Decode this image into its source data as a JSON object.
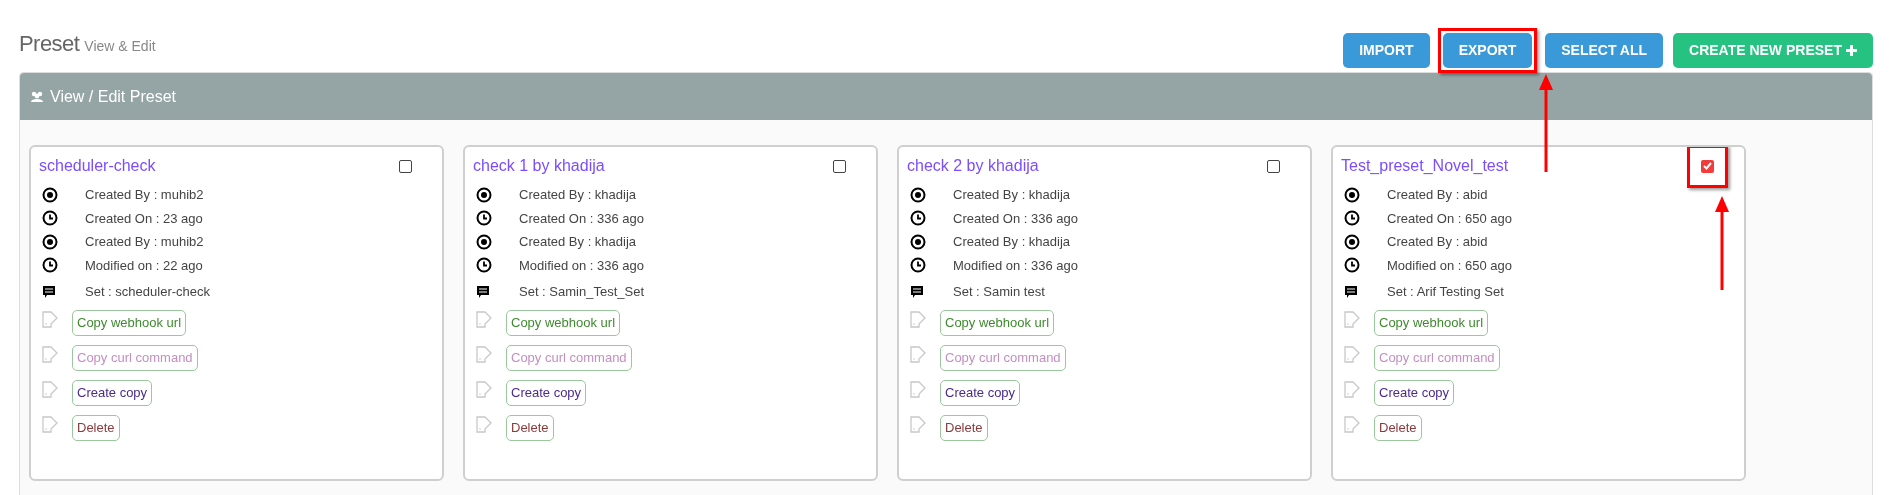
{
  "page": {
    "title": "Preset",
    "subtitle": "View & Edit"
  },
  "buttons": [
    {
      "label": "IMPORT",
      "kind": "blue",
      "highlighted": false
    },
    {
      "label": "EXPORT",
      "kind": "blue",
      "highlighted": true
    },
    {
      "label": "SELECT ALL",
      "kind": "blue",
      "highlighted": false
    },
    {
      "label": "CREATE NEW PRESET",
      "kind": "green",
      "highlighted": false
    }
  ],
  "panel": {
    "title": "View / Edit Preset"
  },
  "cards": [
    {
      "title": "scheduler-check",
      "checked": false,
      "highlighted": false,
      "info": [
        {
          "kind": "user",
          "text": "Created By : muhib2"
        },
        {
          "kind": "time",
          "text": "Created On : 23 ago"
        },
        {
          "kind": "user",
          "text": "Created By : muhib2"
        },
        {
          "kind": "time",
          "text": "Modified on : 22 ago"
        },
        {
          "kind": "set",
          "text": "Set : scheduler-check"
        }
      ],
      "actions": [
        {
          "kind": "webhook",
          "label": "Copy webhook url"
        },
        {
          "kind": "curl",
          "label": "Copy curl command"
        },
        {
          "kind": "copy",
          "label": "Create copy"
        },
        {
          "kind": "delete",
          "label": "Delete"
        }
      ]
    },
    {
      "title": "check 1 by khadija",
      "checked": false,
      "highlighted": false,
      "info": [
        {
          "kind": "user",
          "text": "Created By : khadija"
        },
        {
          "kind": "time",
          "text": "Created On : 336 ago"
        },
        {
          "kind": "user",
          "text": "Created By : khadija"
        },
        {
          "kind": "time",
          "text": "Modified on : 336 ago"
        },
        {
          "kind": "set",
          "text": "Set : Samin_Test_Set"
        }
      ],
      "actions": [
        {
          "kind": "webhook",
          "label": "Copy webhook url"
        },
        {
          "kind": "curl",
          "label": "Copy curl command"
        },
        {
          "kind": "copy",
          "label": "Create copy"
        },
        {
          "kind": "delete",
          "label": "Delete"
        }
      ]
    },
    {
      "title": "check 2 by khadija",
      "checked": false,
      "highlighted": false,
      "info": [
        {
          "kind": "user",
          "text": "Created By : khadija"
        },
        {
          "kind": "time",
          "text": "Created On : 336 ago"
        },
        {
          "kind": "user",
          "text": "Created By : khadija"
        },
        {
          "kind": "time",
          "text": "Modified on : 336 ago"
        },
        {
          "kind": "set",
          "text": "Set : Samin test"
        }
      ],
      "actions": [
        {
          "kind": "webhook",
          "label": "Copy webhook url"
        },
        {
          "kind": "curl",
          "label": "Copy curl command"
        },
        {
          "kind": "copy",
          "label": "Create copy"
        },
        {
          "kind": "delete",
          "label": "Delete"
        }
      ]
    },
    {
      "title": "Test_preset_Novel_test",
      "checked": true,
      "highlighted": true,
      "info": [
        {
          "kind": "user",
          "text": "Created By : abid"
        },
        {
          "kind": "time",
          "text": "Created On : 650 ago"
        },
        {
          "kind": "user",
          "text": "Created By : abid"
        },
        {
          "kind": "time",
          "text": "Modified on : 650 ago"
        },
        {
          "kind": "set",
          "text": "Set : Arif Testing Set"
        }
      ],
      "actions": [
        {
          "kind": "webhook",
          "label": "Copy webhook url"
        },
        {
          "kind": "curl",
          "label": "Copy curl command"
        },
        {
          "kind": "copy",
          "label": "Create copy"
        },
        {
          "kind": "delete",
          "label": "Delete"
        }
      ]
    }
  ]
}
